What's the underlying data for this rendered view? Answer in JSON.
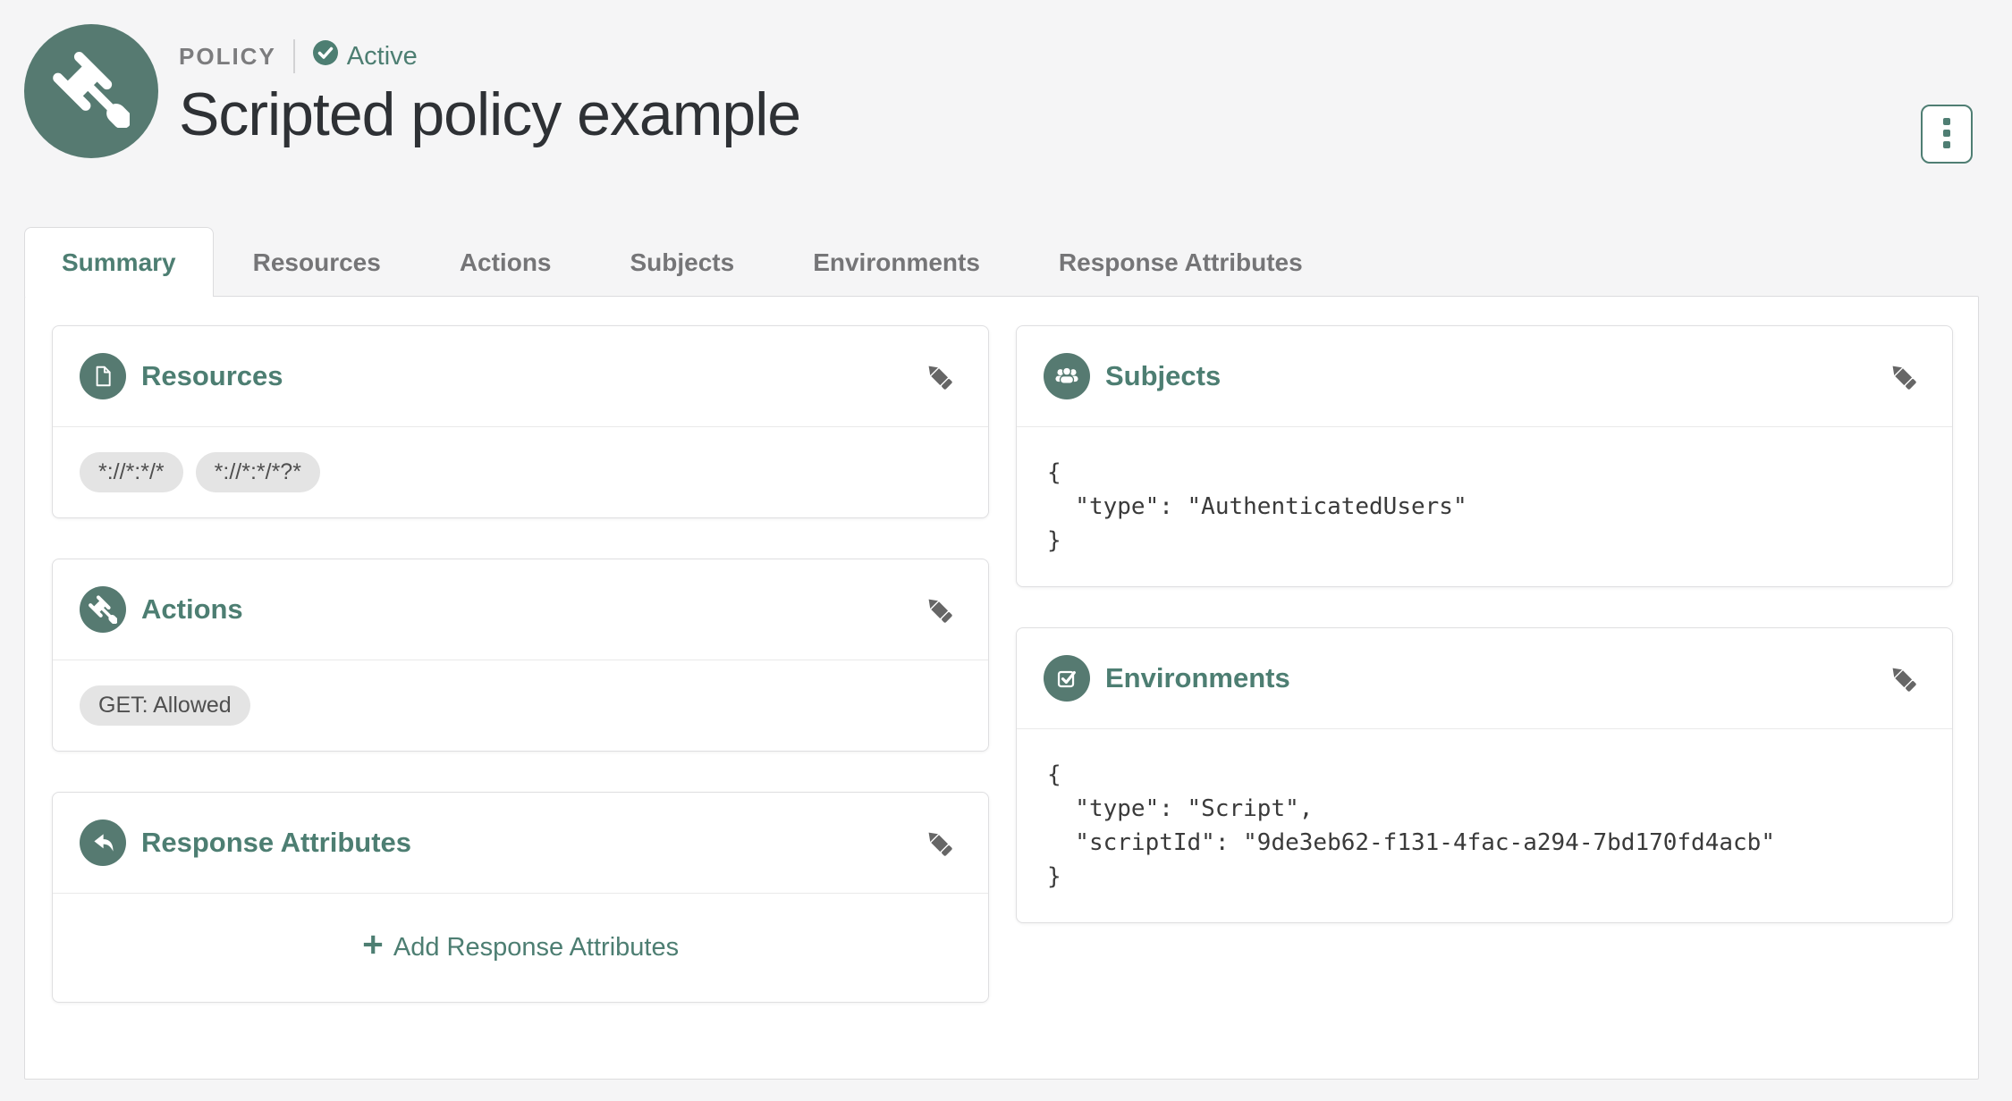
{
  "header": {
    "kicker": "POLICY",
    "status": "Active",
    "title": "Scripted policy example"
  },
  "tabs": [
    {
      "label": "Summary",
      "active": true
    },
    {
      "label": "Resources",
      "active": false
    },
    {
      "label": "Actions",
      "active": false
    },
    {
      "label": "Subjects",
      "active": false
    },
    {
      "label": "Environments",
      "active": false
    },
    {
      "label": "Response Attributes",
      "active": false
    }
  ],
  "cards": {
    "resources": {
      "title": "Resources",
      "icon": "document-icon",
      "tags": [
        "*://*:*/*",
        "*://*:*/*?*"
      ]
    },
    "actions": {
      "title": "Actions",
      "icon": "gavel-icon",
      "tags": [
        "GET: Allowed"
      ]
    },
    "response_attributes": {
      "title": "Response Attributes",
      "icon": "reply-arrow-icon",
      "add_label": "Add Response Attributes"
    },
    "subjects": {
      "title": "Subjects",
      "icon": "users-icon",
      "json": "{\n  \"type\": \"AuthenticatedUsers\"\n}"
    },
    "environments": {
      "title": "Environments",
      "icon": "check-square-icon",
      "json": "{\n  \"type\": \"Script\",\n  \"scriptId\": \"9de3eb62-f131-4fac-a294-7bd170fd4acb\"\n}"
    }
  },
  "colors": {
    "brand_teal": "#567a71",
    "accent_text_teal": "#4d7e72",
    "page_background": "#f5f5f6",
    "card_border": "#dfdfe1",
    "tag_background": "#e4e4e4",
    "inactive_tab_text": "#757577"
  }
}
